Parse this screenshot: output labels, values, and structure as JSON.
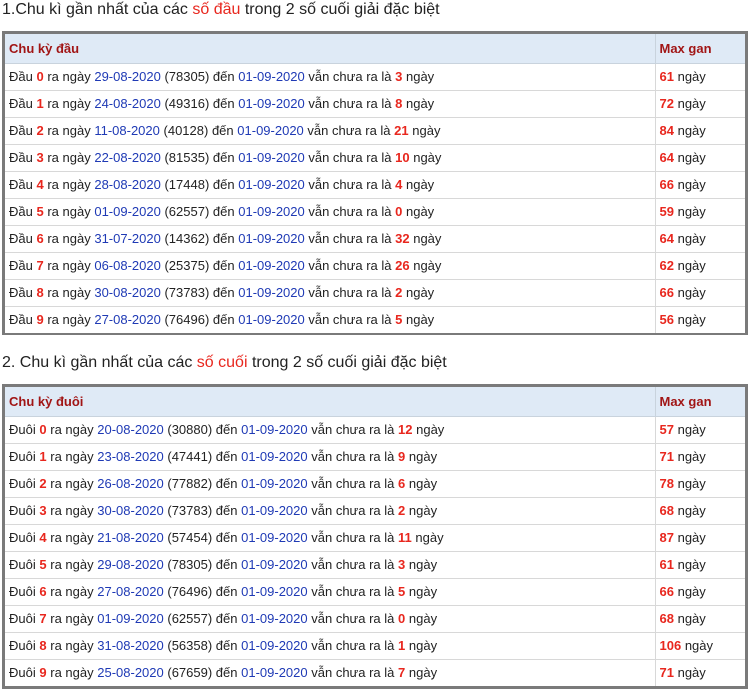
{
  "section1": {
    "title_prefix": "1.Chu kì gần nhất của các ",
    "title_highlight": "số đầu",
    "title_suffix": " trong 2 số cuối giải đặc biệt",
    "col_label": "Chu kỳ đầu",
    "col_max": "Max gan",
    "row_label": "Đầu",
    "rows": [
      {
        "digit": "0",
        "date": "29-08-2020",
        "code": "(78305)",
        "end": "01-09-2020",
        "count": "3",
        "max": "61"
      },
      {
        "digit": "1",
        "date": "24-08-2020",
        "code": "(49316)",
        "end": "01-09-2020",
        "count": "8",
        "max": "72"
      },
      {
        "digit": "2",
        "date": "11-08-2020",
        "code": "(40128)",
        "end": "01-09-2020",
        "count": "21",
        "max": "84"
      },
      {
        "digit": "3",
        "date": "22-08-2020",
        "code": "(81535)",
        "end": "01-09-2020",
        "count": "10",
        "max": "64"
      },
      {
        "digit": "4",
        "date": "28-08-2020",
        "code": "(17448)",
        "end": "01-09-2020",
        "count": "4",
        "max": "66"
      },
      {
        "digit": "5",
        "date": "01-09-2020",
        "code": "(62557)",
        "end": "01-09-2020",
        "count": "0",
        "max": "59"
      },
      {
        "digit": "6",
        "date": "31-07-2020",
        "code": "(14362)",
        "end": "01-09-2020",
        "count": "32",
        "max": "64"
      },
      {
        "digit": "7",
        "date": "06-08-2020",
        "code": "(25375)",
        "end": "01-09-2020",
        "count": "26",
        "max": "62"
      },
      {
        "digit": "8",
        "date": "30-08-2020",
        "code": "(73783)",
        "end": "01-09-2020",
        "count": "2",
        "max": "66"
      },
      {
        "digit": "9",
        "date": "27-08-2020",
        "code": "(76496)",
        "end": "01-09-2020",
        "count": "5",
        "max": "56"
      }
    ]
  },
  "section2": {
    "title_prefix": "2. Chu kì gần nhất của các ",
    "title_highlight": "số cuối",
    "title_suffix": " trong 2 số cuối giải đặc biệt",
    "col_label": "Chu kỳ đuôi",
    "col_max": "Max gan",
    "row_label": "Đuôi",
    "rows": [
      {
        "digit": "0",
        "date": "20-08-2020",
        "code": "(30880)",
        "end": "01-09-2020",
        "count": "12",
        "max": "57"
      },
      {
        "digit": "1",
        "date": "23-08-2020",
        "code": "(47441)",
        "end": "01-09-2020",
        "count": "9",
        "max": "71"
      },
      {
        "digit": "2",
        "date": "26-08-2020",
        "code": "(77882)",
        "end": "01-09-2020",
        "count": "6",
        "max": "78"
      },
      {
        "digit": "3",
        "date": "30-08-2020",
        "code": "(73783)",
        "end": "01-09-2020",
        "count": "2",
        "max": "68"
      },
      {
        "digit": "4",
        "date": "21-08-2020",
        "code": "(57454)",
        "end": "01-09-2020",
        "count": "11",
        "max": "87"
      },
      {
        "digit": "5",
        "date": "29-08-2020",
        "code": "(78305)",
        "end": "01-09-2020",
        "count": "3",
        "max": "61"
      },
      {
        "digit": "6",
        "date": "27-08-2020",
        "code": "(76496)",
        "end": "01-09-2020",
        "count": "5",
        "max": "66"
      },
      {
        "digit": "7",
        "date": "01-09-2020",
        "code": "(62557)",
        "end": "01-09-2020",
        "count": "0",
        "max": "68"
      },
      {
        "digit": "8",
        "date": "31-08-2020",
        "code": "(56358)",
        "end": "01-09-2020",
        "count": "1",
        "max": "106"
      },
      {
        "digit": "9",
        "date": "25-08-2020",
        "code": "(67659)",
        "end": "01-09-2020",
        "count": "7",
        "max": "71"
      }
    ]
  },
  "phrases": {
    "ra_ngay": "ra ngày",
    "den": "đến",
    "van_chua": "vẫn chưa ra là",
    "ngay": "ngày"
  },
  "colors": {
    "highlight": "#e8271e",
    "date_blue": "#1f3ab5",
    "header_bg": "#dfeaf6",
    "header_text": "#a11515",
    "frame": "#7a7a7a"
  }
}
